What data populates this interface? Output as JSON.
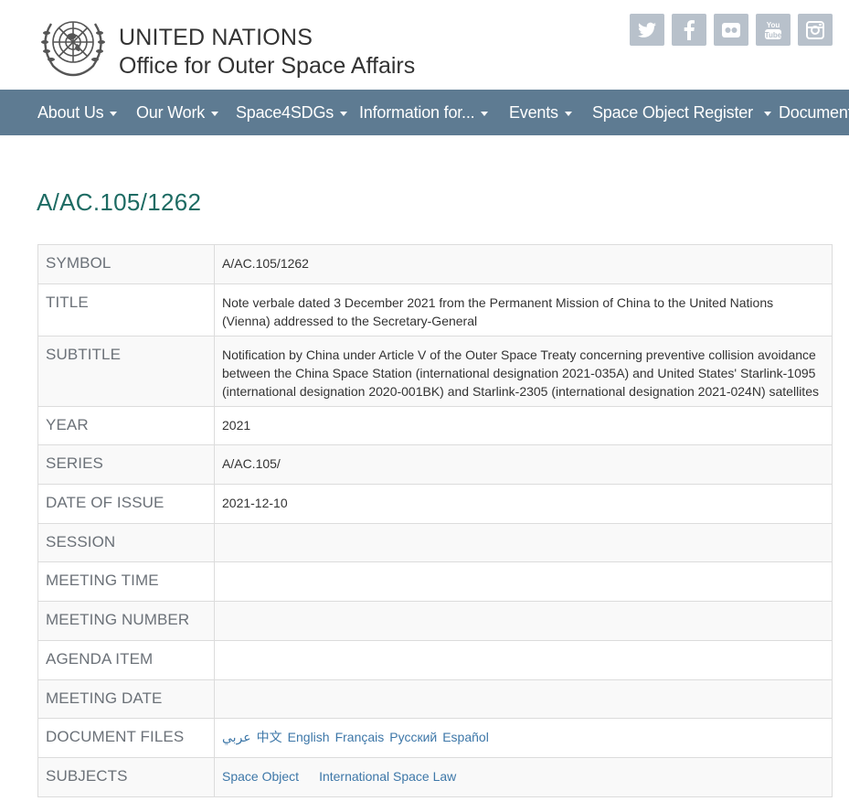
{
  "header": {
    "org_line1": "UNITED NATIONS",
    "org_line2": "Office for Outer Space Affairs",
    "logo_icon": "un-emblem-icon",
    "social": [
      {
        "name": "twitter-icon"
      },
      {
        "name": "facebook-icon"
      },
      {
        "name": "flickr-icon"
      },
      {
        "name": "youtube-icon",
        "label": "You Tube"
      },
      {
        "name": "instagram-icon"
      }
    ],
    "colors": {
      "social_bg": "#b8c1cb",
      "nav_bg": "#5e7b92",
      "title": "#1d6b63",
      "link": "#3d77a8"
    }
  },
  "nav": {
    "items": [
      "About Us",
      "Our Work",
      "Space4SDGs",
      "Information for...",
      "Events",
      "Space Object Register",
      "Documents"
    ]
  },
  "page": {
    "title": "A/AC.105/1262"
  },
  "table": {
    "rows": [
      {
        "label": "SYMBOL",
        "value": "A/AC.105/1262"
      },
      {
        "label": "TITLE",
        "value": "Note verbale dated 3 December 2021 from the Permanent Mission of China to the United Nations (Vienna) addressed to the Secretary-General"
      },
      {
        "label": "SUBTITLE",
        "value": "Notification by China under Article V of the Outer Space Treaty concerning preventive collision avoidance between the China Space Station (international designation 2021-035A) and United States' Starlink-1095 (international designation 2020-001BK) and Starlink-2305 (international designation 2021-024N) satellites"
      },
      {
        "label": "YEAR",
        "value": "2021"
      },
      {
        "label": "SERIES",
        "value": "A/AC.105/"
      },
      {
        "label": "DATE OF ISSUE",
        "value": "2021-12-10"
      },
      {
        "label": "SESSION",
        "value": ""
      },
      {
        "label": "MEETING TIME",
        "value": ""
      },
      {
        "label": "MEETING NUMBER",
        "value": ""
      },
      {
        "label": "AGENDA ITEM",
        "value": ""
      },
      {
        "label": "MEETING DATE",
        "value": ""
      },
      {
        "label": "DOCUMENT FILES",
        "files": [
          "عربي",
          "中文",
          "English",
          "Français",
          "Русский",
          "Español"
        ]
      },
      {
        "label": "SUBJECTS",
        "subjects": [
          "Space Object",
          "International Space Law"
        ]
      }
    ]
  }
}
